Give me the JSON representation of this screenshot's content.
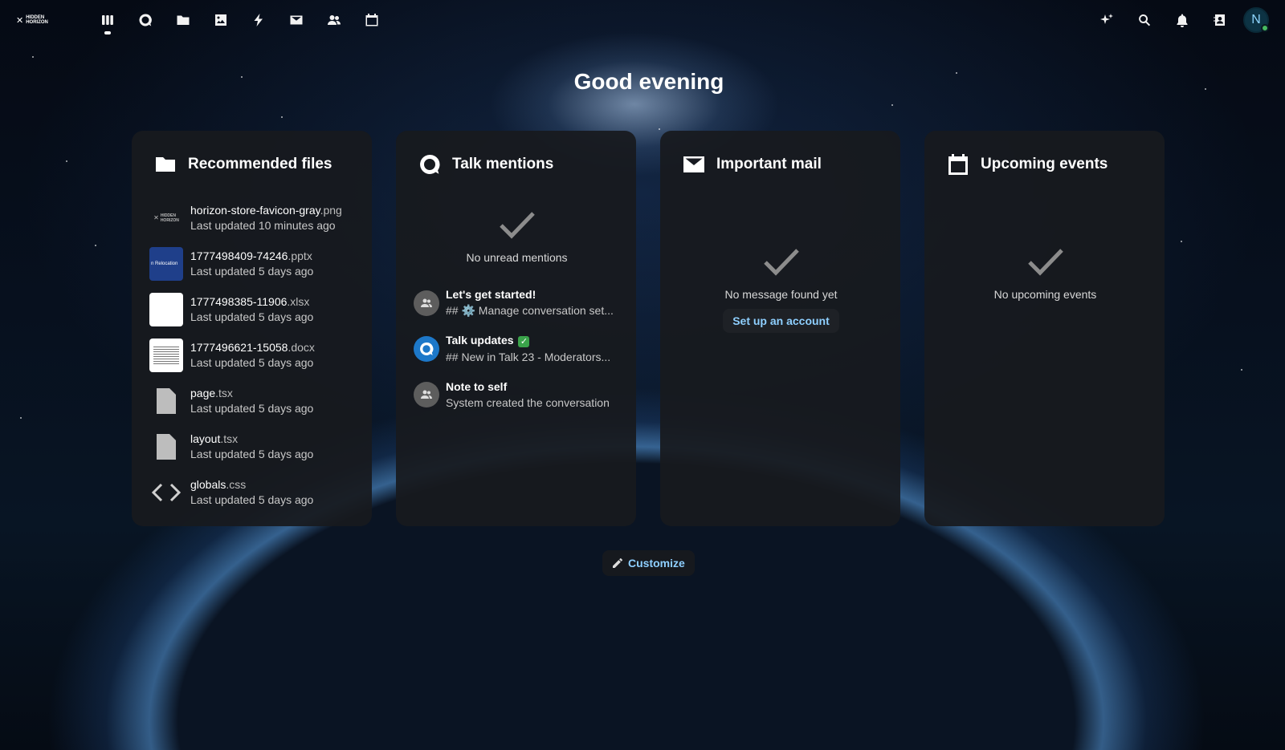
{
  "brand": {
    "logo_text_line1": "HIDDEN",
    "logo_text_line2": "HORIZON"
  },
  "nav": [
    {
      "name": "dashboard",
      "icon": "dashboard-icon",
      "active": true
    },
    {
      "name": "talk",
      "icon": "talk-icon"
    },
    {
      "name": "files",
      "icon": "folder-icon"
    },
    {
      "name": "photos",
      "icon": "image-icon"
    },
    {
      "name": "activity",
      "icon": "lightning-icon"
    },
    {
      "name": "mail",
      "icon": "mail-icon"
    },
    {
      "name": "contacts",
      "icon": "contacts-icon"
    },
    {
      "name": "calendar",
      "icon": "calendar-icon"
    }
  ],
  "header_right": [
    "assistant-sparkle-icon",
    "search-icon",
    "bell-icon",
    "contacts-menu-icon"
  ],
  "user": {
    "initial": "N",
    "status": "online",
    "status_color": "#46ba61"
  },
  "greeting": "Good evening",
  "panels": {
    "files": {
      "title": "Recommended files",
      "items": [
        {
          "base": "horizon-store-favicon-gray",
          "ext": ".png",
          "meta": "Last updated 10 minutes ago",
          "thumb": "logo"
        },
        {
          "base": "1777498409-74246",
          "ext": ".pptx",
          "meta": "Last updated 5 days ago",
          "thumb": "pptx",
          "thumb_text": "n Relocation"
        },
        {
          "base": "1777498385-11906",
          "ext": ".xlsx",
          "meta": "Last updated 5 days ago",
          "thumb": "xlsx"
        },
        {
          "base": "1777496621-15058",
          "ext": ".docx",
          "meta": "Last updated 5 days ago",
          "thumb": "docx"
        },
        {
          "base": "page",
          "ext": ".tsx",
          "meta": "Last updated 5 days ago",
          "thumb": "generic"
        },
        {
          "base": "layout",
          "ext": ".tsx",
          "meta": "Last updated 5 days ago",
          "thumb": "generic"
        },
        {
          "base": "globals",
          "ext": ".css",
          "meta": "Last updated 5 days ago",
          "thumb": "code"
        }
      ]
    },
    "talk": {
      "title": "Talk mentions",
      "empty_text": "No unread mentions",
      "items": [
        {
          "name": "Let's get started!",
          "sub": "## ⚙️ Manage conversation set...",
          "avatar": "group"
        },
        {
          "name": "Talk updates",
          "badge": "✓",
          "sub": "## New in Talk 23 - Moderators...",
          "avatar": "talk"
        },
        {
          "name": "Note to self",
          "sub": "System created the conversation",
          "avatar": "group"
        }
      ]
    },
    "mail": {
      "title": "Important mail",
      "empty_text": "No message found yet",
      "action_label": "Set up an account"
    },
    "events": {
      "title": "Upcoming events",
      "empty_text": "No upcoming events"
    }
  },
  "customize_label": "Customize",
  "colors": {
    "accent": "#8ecfff",
    "panel_bg": "#18191e",
    "talk_blue": "#1d78c9"
  }
}
